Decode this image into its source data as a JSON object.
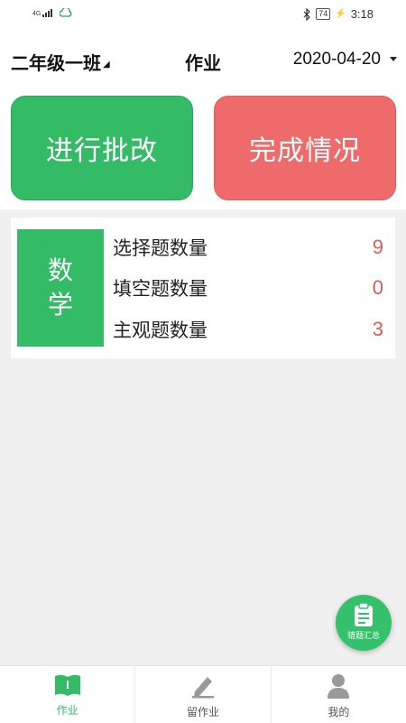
{
  "status_bar": {
    "network": "4G",
    "battery": "74",
    "time": "3:18"
  },
  "header": {
    "class_name": "二年级一班",
    "title": "作业",
    "date": "2020-04-20"
  },
  "actions": {
    "grade_label": "进行批改",
    "completion_label": "完成情况"
  },
  "subject_card": {
    "subject_line1": "数",
    "subject_line2": "学",
    "questions": [
      {
        "label": "选择题数量",
        "count": "9"
      },
      {
        "label": "填空题数量",
        "count": "0"
      },
      {
        "label": "主观题数量",
        "count": "3"
      }
    ]
  },
  "fab": {
    "label": "错题汇总",
    "icon": "clipboard-icon"
  },
  "tabs": [
    {
      "label": "作业",
      "icon": "book-icon",
      "active": true
    },
    {
      "label": "留作业",
      "icon": "pencil-icon",
      "active": false
    },
    {
      "label": "我的",
      "icon": "person-icon",
      "active": false
    }
  ],
  "colors": {
    "primary_green": "#33bb66",
    "accent_red": "#ef6a6a",
    "count_red": "#e0594d"
  }
}
